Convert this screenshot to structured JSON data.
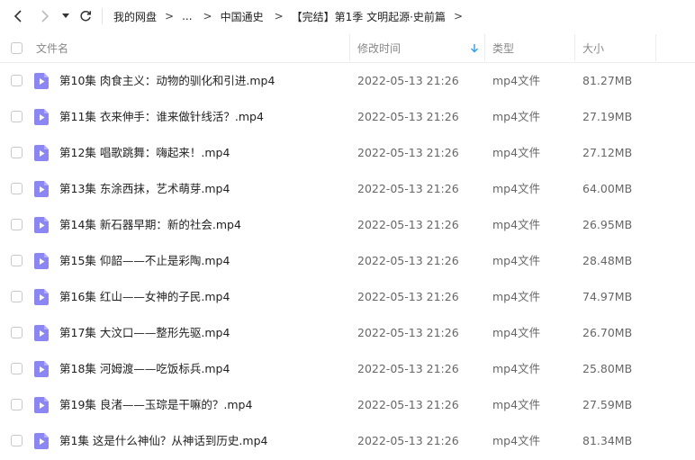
{
  "toolbar": {
    "back_icon": "back-arrow-icon",
    "forward_icon": "forward-arrow-icon",
    "history_icon": "dropdown-caret-icon",
    "refresh_icon": "refresh-icon"
  },
  "breadcrumb": {
    "items": [
      "我的网盘",
      "...",
      "中国通史",
      "【完结】第1季 文明起源·史前篇"
    ],
    "separator": ">"
  },
  "header": {
    "name": "文件名",
    "modified": "修改时间",
    "type": "类型",
    "size": "大小",
    "sort_icon": "sort-down-arrow-icon"
  },
  "colors": {
    "accent": "#2f9ee8",
    "file_icon": "#8b86f4"
  },
  "files": [
    {
      "name": "第10集 肉食主义：动物的驯化和引进.mp4",
      "modified": "2022-05-13 21:26",
      "type": "mp4文件",
      "size": "81.27MB"
    },
    {
      "name": "第11集 衣来伸手：谁来做针线活？.mp4",
      "modified": "2022-05-13 21:26",
      "type": "mp4文件",
      "size": "27.19MB"
    },
    {
      "name": "第12集 唱歌跳舞：嗨起来！.mp4",
      "modified": "2022-05-13 21:26",
      "type": "mp4文件",
      "size": "27.12MB"
    },
    {
      "name": "第13集 东涂西抹，艺术萌芽.mp4",
      "modified": "2022-05-13 21:26",
      "type": "mp4文件",
      "size": "64.00MB"
    },
    {
      "name": "第14集 新石器早期：新的社会.mp4",
      "modified": "2022-05-13 21:26",
      "type": "mp4文件",
      "size": "26.95MB"
    },
    {
      "name": "第15集 仰韶——不止是彩陶.mp4",
      "modified": "2022-05-13 21:26",
      "type": "mp4文件",
      "size": "28.48MB"
    },
    {
      "name": "第16集 红山——女神的子民.mp4",
      "modified": "2022-05-13 21:26",
      "type": "mp4文件",
      "size": "74.97MB"
    },
    {
      "name": "第17集 大汶口——整形先驱.mp4",
      "modified": "2022-05-13 21:26",
      "type": "mp4文件",
      "size": "26.70MB"
    },
    {
      "name": "第18集 河姆渡——吃饭标兵.mp4",
      "modified": "2022-05-13 21:26",
      "type": "mp4文件",
      "size": "25.80MB"
    },
    {
      "name": "第19集 良渚——玉琮是干嘛的？.mp4",
      "modified": "2022-05-13 21:26",
      "type": "mp4文件",
      "size": "27.59MB"
    },
    {
      "name": "第1集 这是什么神仙？从神话到历史.mp4",
      "modified": "2022-05-13 21:26",
      "type": "mp4文件",
      "size": "81.34MB"
    }
  ]
}
